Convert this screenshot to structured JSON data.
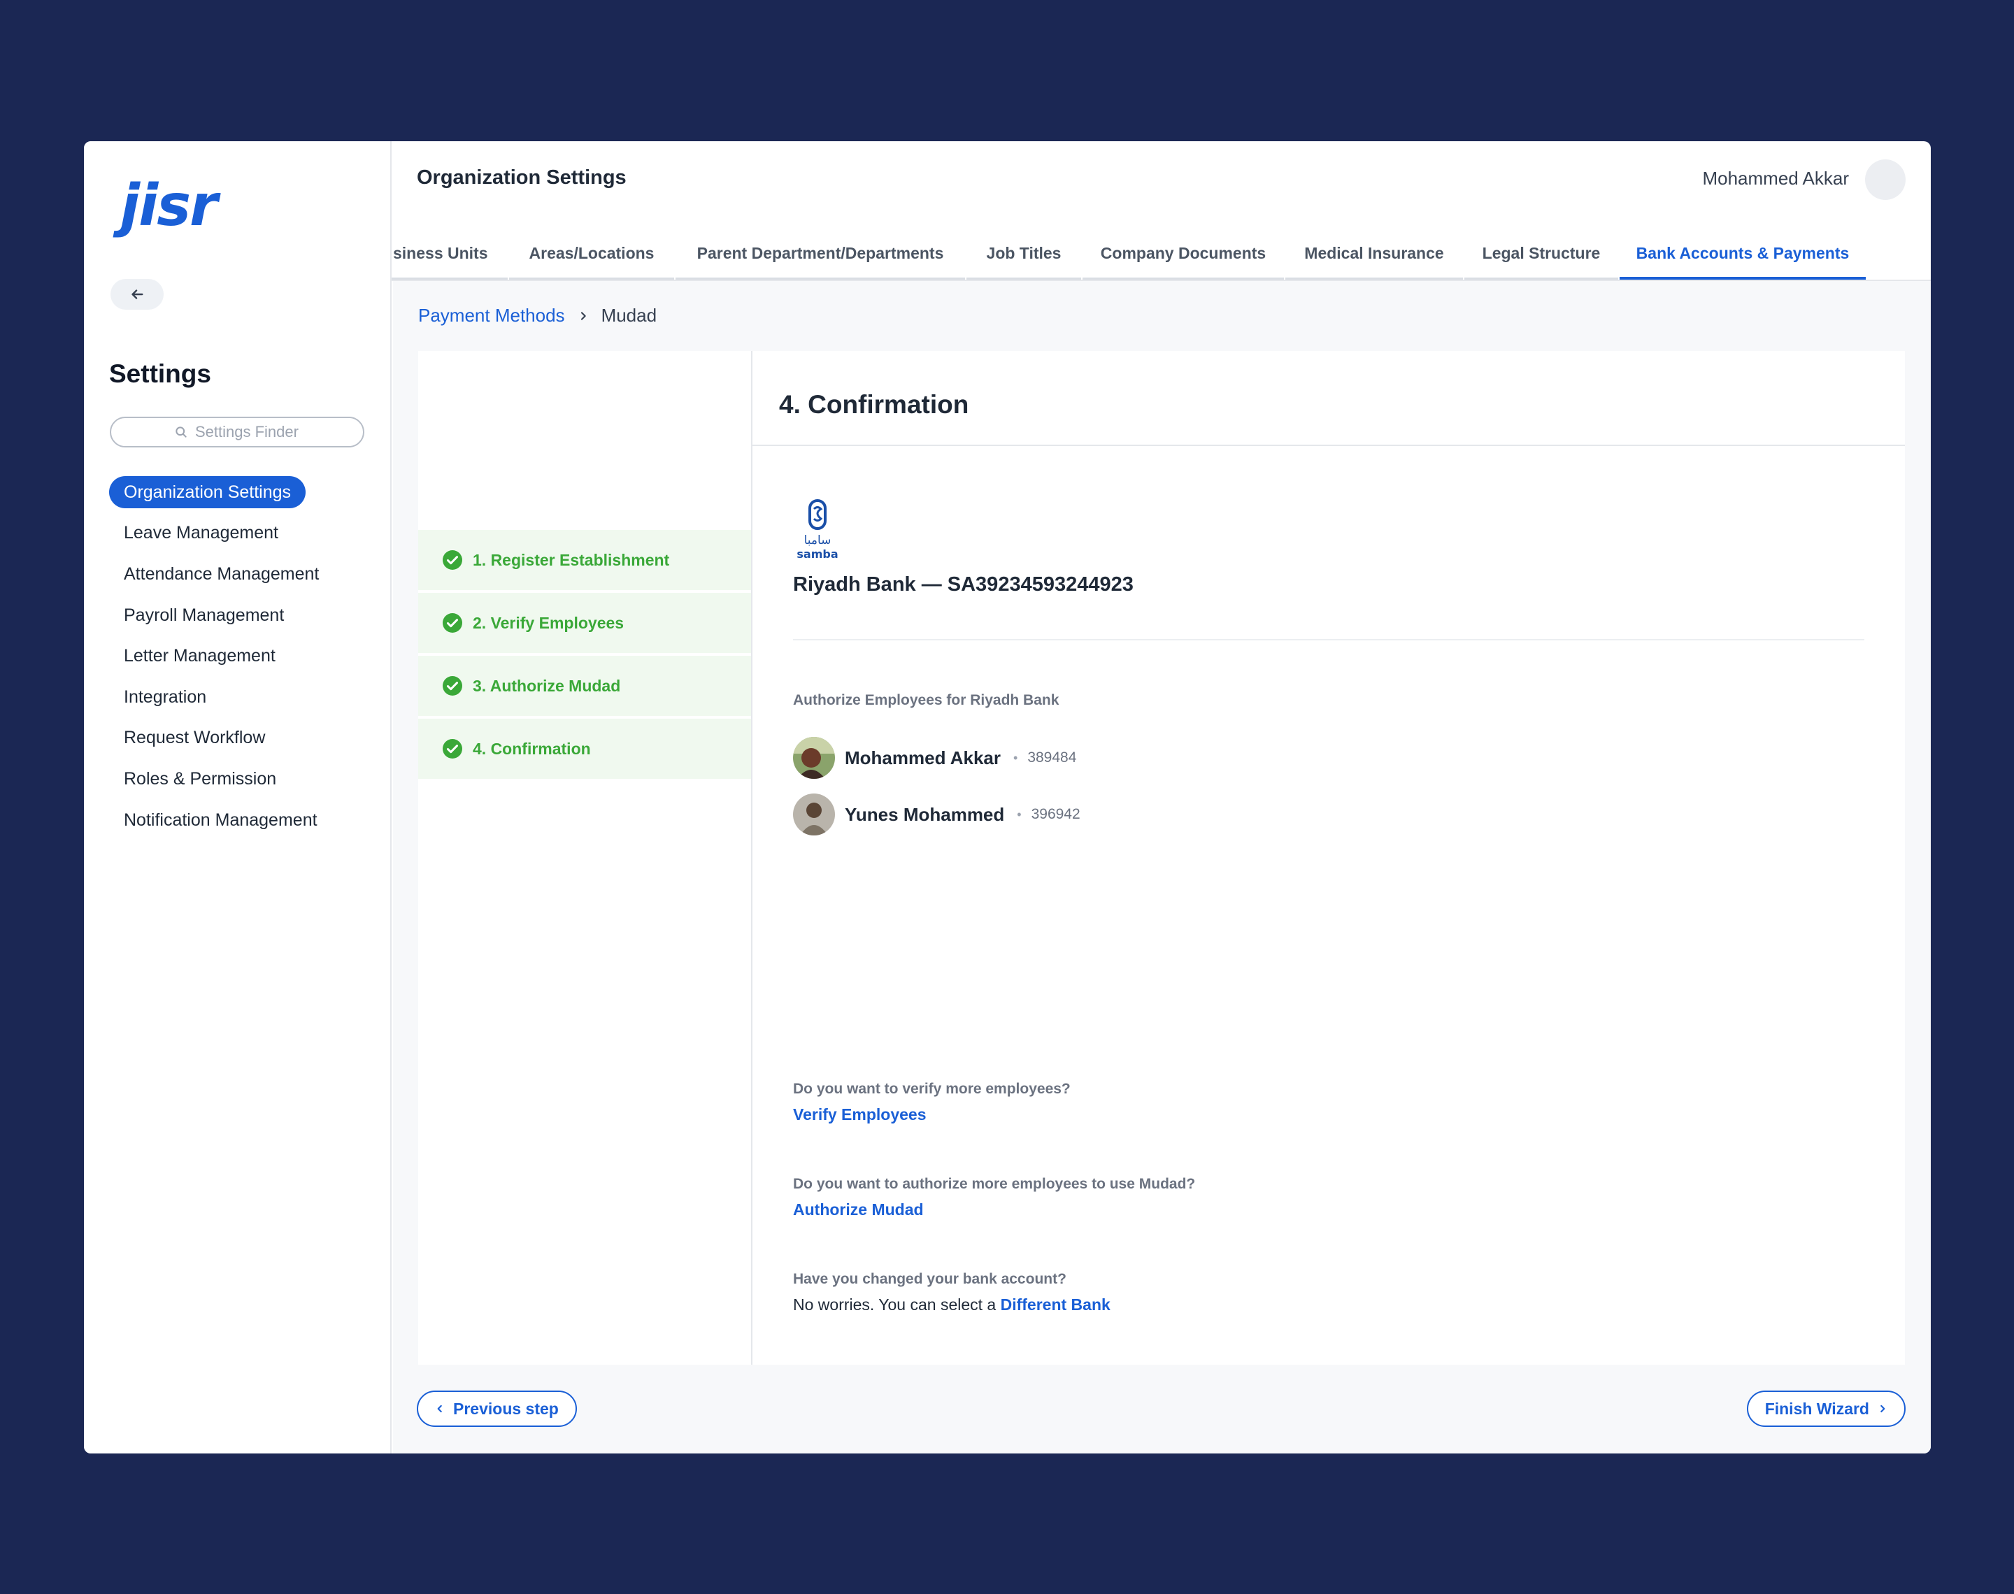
{
  "sidebar": {
    "logo": "jisr",
    "title": "Settings",
    "finder_placeholder": "Settings Finder",
    "items": [
      {
        "label": "Organization Settings",
        "active": true
      },
      {
        "label": "Leave Management"
      },
      {
        "label": "Attendance Management"
      },
      {
        "label": "Payroll Management"
      },
      {
        "label": "Letter Management"
      },
      {
        "label": "Integration"
      },
      {
        "label": "Request Workflow"
      },
      {
        "label": "Roles & Permission"
      },
      {
        "label": "Notification Management"
      }
    ]
  },
  "header": {
    "title": "Organization Settings",
    "user_name": "Mohammed Akkar"
  },
  "tabs": [
    {
      "label": "siness Units"
    },
    {
      "label": "Areas/Locations"
    },
    {
      "label": "Parent Department/Departments"
    },
    {
      "label": "Job Titles"
    },
    {
      "label": "Company Documents"
    },
    {
      "label": "Medical Insurance"
    },
    {
      "label": "Legal Structure"
    },
    {
      "label": "Bank Accounts & Payments",
      "active": true
    }
  ],
  "breadcrumb": {
    "parent": "Payment Methods",
    "current": "Mudad"
  },
  "steps": [
    {
      "label": "1. Register Establishment"
    },
    {
      "label": "2. Verify Employees"
    },
    {
      "label": "3. Authorize Mudad"
    },
    {
      "label": "4. Confirmation"
    }
  ],
  "confirmation": {
    "title": "4. Confirmation",
    "bank_logo_text": "samba",
    "bank_logo_arabic": "سامبا",
    "bank_line": "Riyadh Bank — SA39234593244923",
    "authorize_title": "Authorize Employees for Riyadh Bank",
    "employees": [
      {
        "name": "Mohammed Akkar",
        "id": "389484"
      },
      {
        "name": "Yunes Mohammed",
        "id": "396942"
      }
    ],
    "verify_question": "Do you want to verify more employees?",
    "verify_link": "Verify Employees",
    "authorize_question": "Do you want to authorize more employees to use Mudad?",
    "authorize_link": "Authorize Mudad",
    "bank_question": "Have you changed your bank account?",
    "bank_answer_prefix": "No worries. You can select a",
    "bank_answer_link": "Different Bank"
  },
  "footer": {
    "prev_label": "Previous step",
    "finish_label": "Finish Wizard"
  },
  "colors": {
    "background": "#1b2754",
    "accent": "#1a5fd6",
    "success": "#3aa838"
  }
}
